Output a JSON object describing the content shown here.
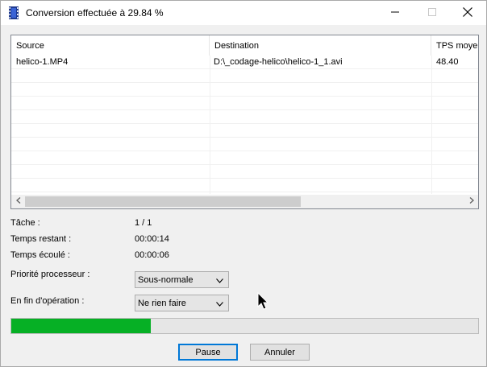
{
  "window": {
    "title": "Conversion effectuée à 29.84 %"
  },
  "listview": {
    "columns": [
      "Source",
      "Destination",
      "TPS moyen"
    ],
    "rows": [
      [
        "helico-1.MP4",
        "D:\\_codage-helico\\helico-1_1.avi",
        "48.40"
      ]
    ]
  },
  "info": {
    "task_label": "Tâche :",
    "task_value": "1 / 1",
    "remaining_label": "Temps restant :",
    "remaining_value": "00:00:14",
    "elapsed_label": "Temps écoulé :",
    "elapsed_value": "00:00:06"
  },
  "options": {
    "priority_label": "Priorité processeur :",
    "priority_value": "Sous-normale",
    "end_label": "En fin d'opération :",
    "end_value": "Ne rien faire"
  },
  "progress": {
    "percent": 29.84,
    "color": "#06b025"
  },
  "buttons": {
    "pause": "Pause",
    "cancel": "Annuler"
  },
  "icons": {
    "app": "film-icon",
    "minimize": "minimize-icon",
    "maximize": "maximize-icon",
    "close": "close-icon"
  }
}
